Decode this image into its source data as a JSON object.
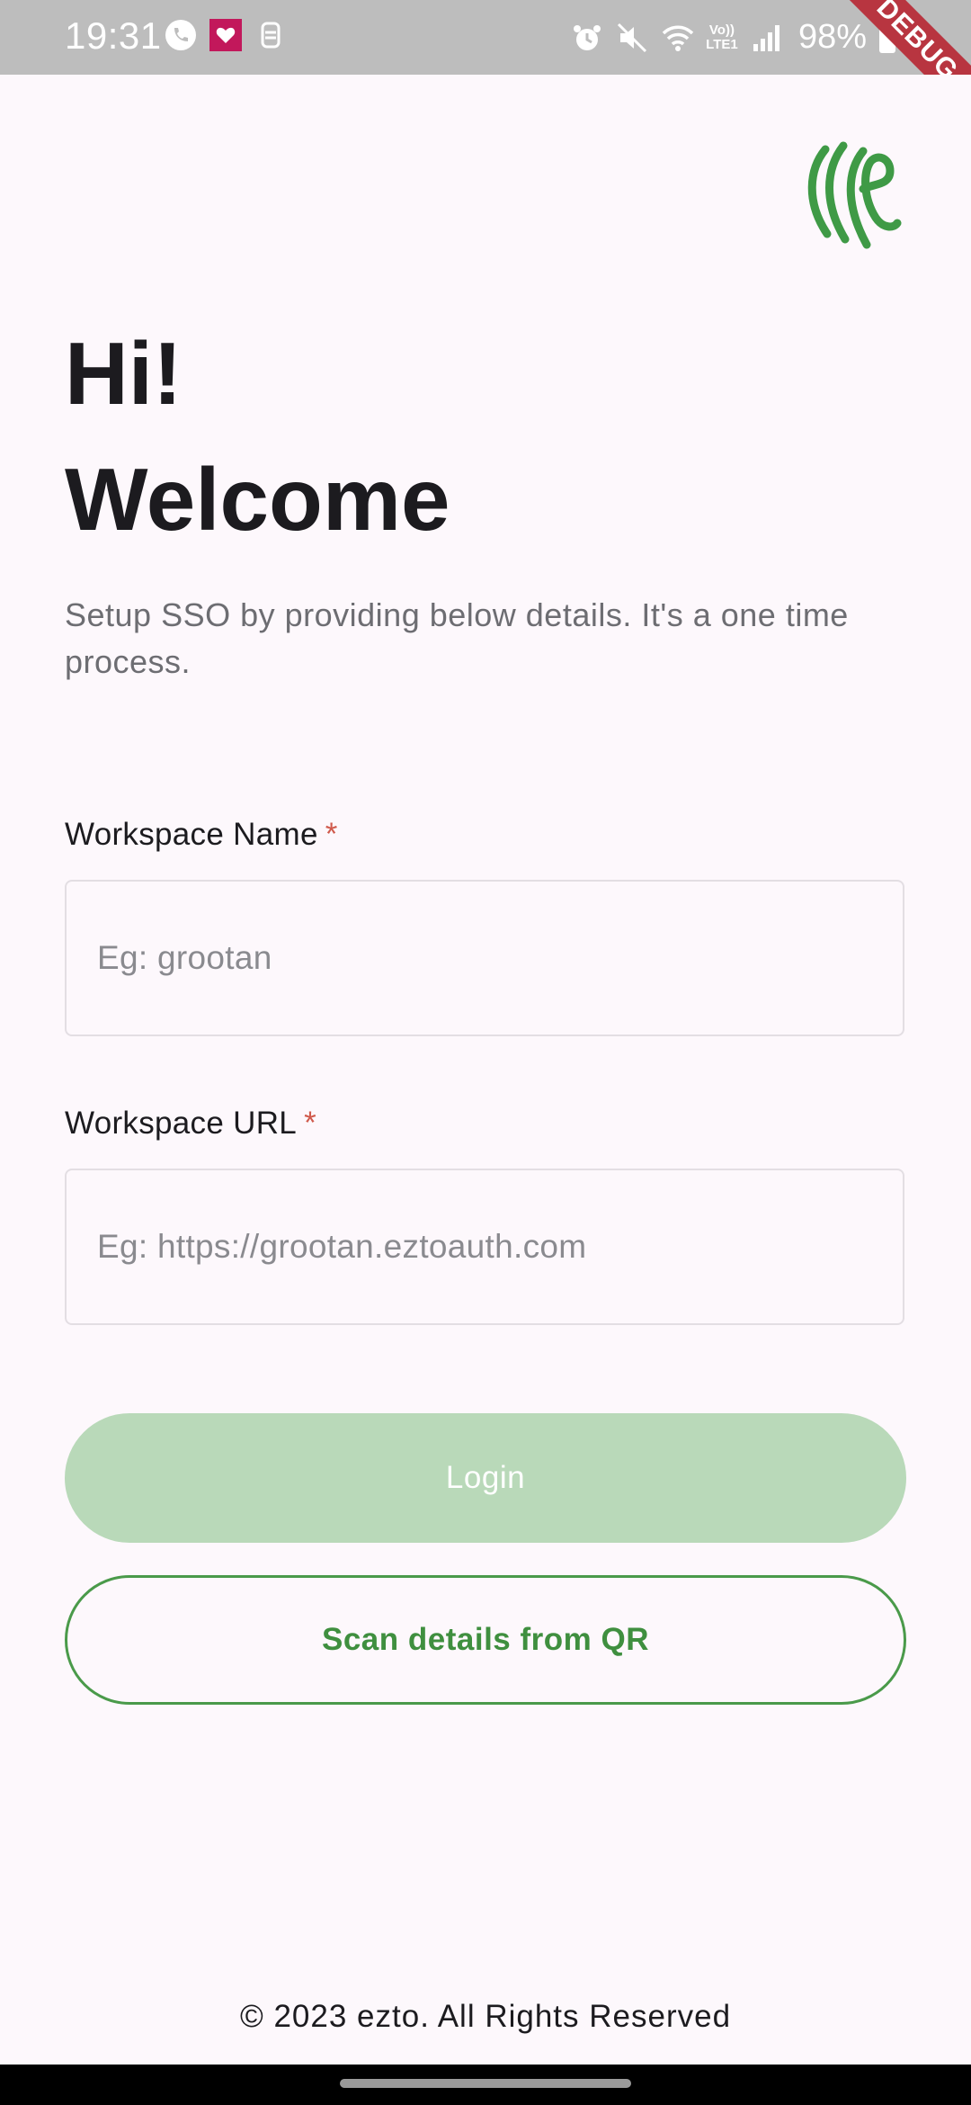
{
  "status_bar": {
    "time": "19:31",
    "battery": "98%",
    "left_icons": [
      "phone-call-icon",
      "heart-app-icon",
      "notification-app-icon"
    ],
    "right_icons": [
      "alarm-icon",
      "mute-icon",
      "wifi-icon",
      "volte-icon",
      "signal-icon",
      "battery-icon"
    ],
    "network_label": "Vo)) LTE1"
  },
  "debug_banner": "DEBUG",
  "brand": {
    "logo_icon": "ezto-logo-icon",
    "accent_color": "#3f8f3f"
  },
  "header": {
    "greeting": "Hi!",
    "welcome": "Welcome",
    "subtitle": "Setup SSO by providing below details. It's a one time process."
  },
  "form": {
    "workspace_name": {
      "label": "Workspace Name",
      "required_marker": "*",
      "placeholder": "Eg: grootan",
      "value": ""
    },
    "workspace_url": {
      "label": "Workspace URL",
      "required_marker": "*",
      "placeholder": "Eg: https://grootan.eztoauth.com",
      "value": ""
    }
  },
  "actions": {
    "login_label": "Login",
    "scan_label": "Scan details from QR"
  },
  "footer": {
    "copyright": "© 2023 ezto. All Rights Reserved"
  }
}
